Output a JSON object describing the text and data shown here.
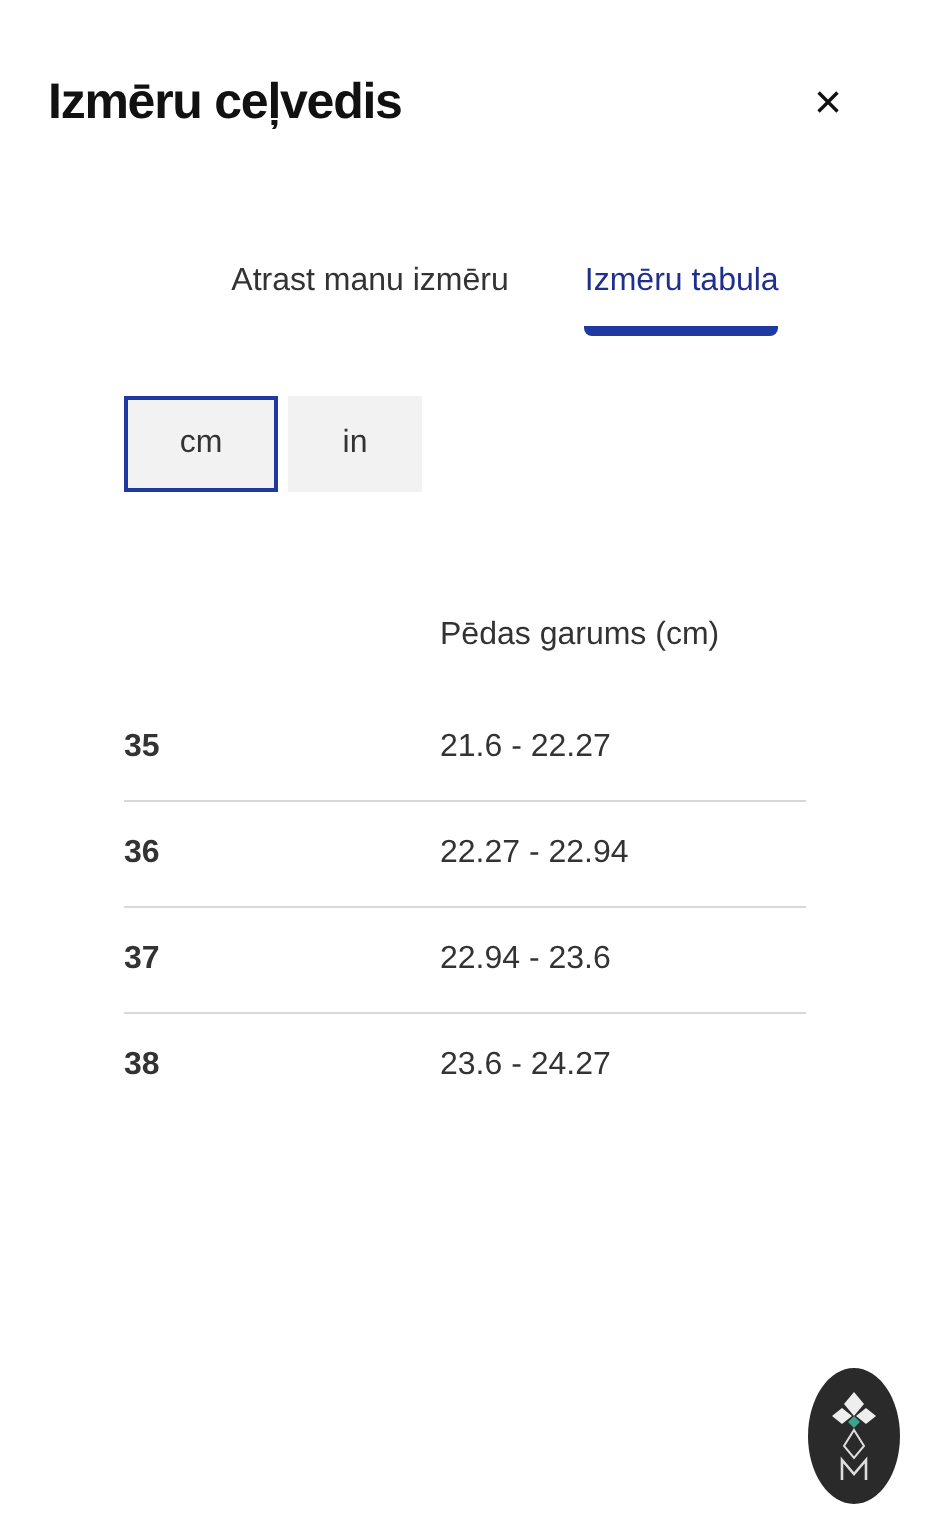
{
  "title": "Izmēru ceļvedis",
  "close": "×",
  "tabs": [
    {
      "label": "Atrast manu izmēru",
      "selected": false
    },
    {
      "label": "Izmēru tabula",
      "selected": true
    }
  ],
  "units": [
    {
      "label": "cm",
      "selected": true
    },
    {
      "label": "in",
      "selected": false
    }
  ],
  "table": {
    "columns": [
      "Pēdas garums (cm)"
    ],
    "rows": [
      {
        "size": "35",
        "length": "21.6 - 22.27"
      },
      {
        "size": "36",
        "length": "22.27 - 22.94"
      },
      {
        "size": "37",
        "length": "22.94 - 23.6"
      },
      {
        "size": "38",
        "length": "23.6 - 24.27"
      }
    ]
  }
}
